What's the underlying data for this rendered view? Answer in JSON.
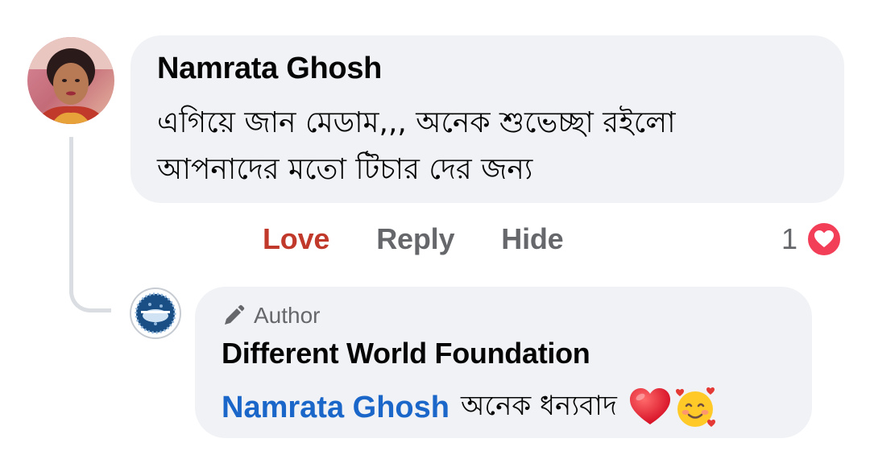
{
  "comment": {
    "author": "Namrata Ghosh",
    "text_lines": [
      "এগিয়ে জান মেডাম,,, অনেক শুভেচ্ছা রইলো",
      "আপনাদের মতো টিচার দের জন্য"
    ],
    "actions": {
      "love": "Love",
      "reply": "Reply",
      "hide": "Hide"
    },
    "reaction_count": "1",
    "reaction_icon": "love-reaction-icon"
  },
  "reply": {
    "badge_icon": "pencil-icon",
    "badge_label": "Author",
    "author": "Different World Foundation",
    "mention": "Namrata Ghosh",
    "text": "অনেক ধন্যবাদ",
    "emojis": [
      "red-heart-emoji",
      "smiling-face-with-hearts-emoji"
    ]
  },
  "colors": {
    "bubble": "#f0f2f5",
    "love": "#c0392b",
    "mention": "#1b66c9",
    "muted": "#65676b"
  }
}
